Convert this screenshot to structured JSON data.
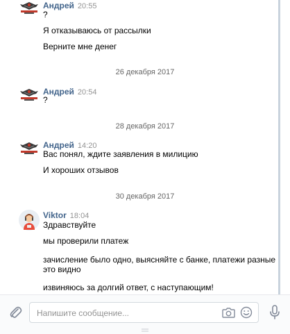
{
  "messages": [
    {
      "author": "Андрей",
      "time": "20:55",
      "avatar": "emblem-avatar",
      "lines": [
        "?",
        "Я отказываюсь от рассылки",
        "Верните мне денег"
      ]
    },
    {
      "author": "Андрей",
      "time": "20:54",
      "avatar": "emblem-avatar",
      "lines": [
        "?"
      ]
    },
    {
      "author": "Андрей",
      "time": "14:20",
      "avatar": "emblem-avatar",
      "lines": [
        "Вас понял, ждите заявления в милицию",
        "И хороших отзывов"
      ]
    },
    {
      "author": "Viktor",
      "time": "18:04",
      "avatar": "support-agent-avatar",
      "lines": [
        "Здравствуйте",
        "мы проверили платеж",
        "зачисление было одно, выясняйте с банке, платежи разные и",
        "это видно",
        "извиняюсь за долгий ответ, с наступающим!"
      ]
    }
  ],
  "dates": [
    "26 декабря 2017",
    "28 декабря 2017",
    "30 декабря 2017"
  ],
  "composer": {
    "placeholder": "Напишите сообщение...",
    "icons": [
      "paperclip-icon",
      "camera-icon",
      "smile-icon",
      "microphone-icon"
    ]
  },
  "colors": {
    "author": "#42648b",
    "time": "#939393",
    "date": "#656565",
    "scrollbar": "#c9d3dd"
  }
}
